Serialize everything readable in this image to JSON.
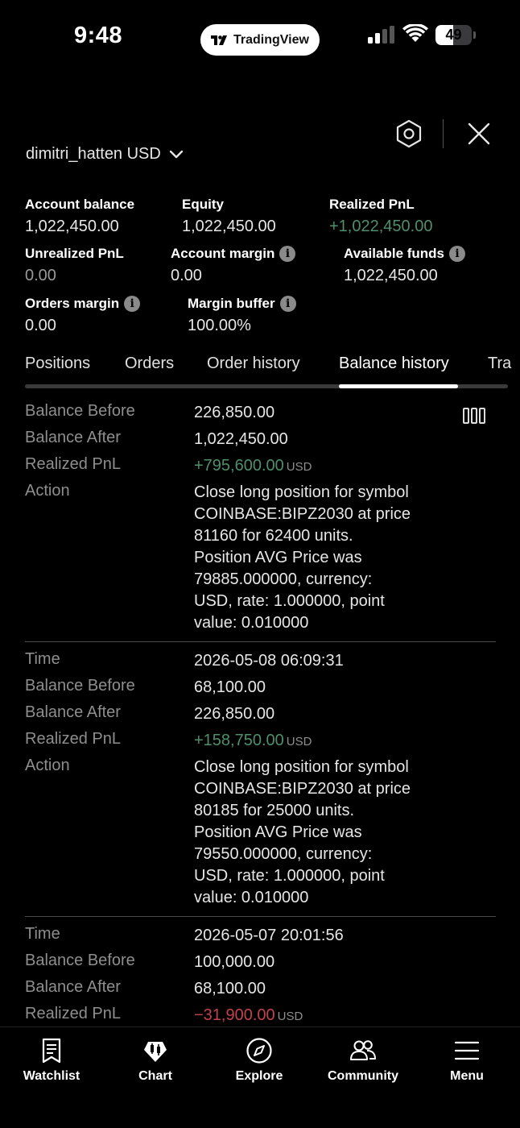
{
  "status_bar": {
    "time": "9:48",
    "app_name": "TradingView",
    "battery_percent": 49
  },
  "header": {
    "account_name": "dimitri_hatten USD",
    "icons": [
      "settings-hexagon-icon",
      "close-icon",
      "chevron-down-icon"
    ]
  },
  "stats": {
    "account_balance": {
      "label": "Account balance",
      "value": "1,022,450.00"
    },
    "equity": {
      "label": "Equity",
      "value": "1,022,450.00"
    },
    "realized_pnl": {
      "label": "Realized PnL",
      "value": "+1,022,450.00"
    },
    "unrealized_pnl": {
      "label": "Unrealized PnL",
      "value": "0.00"
    },
    "account_margin": {
      "label": "Account margin",
      "value": "0.00"
    },
    "available_funds": {
      "label": "Available funds",
      "value": "1,022,450.00"
    },
    "orders_margin": {
      "label": "Orders margin",
      "value": "0.00"
    },
    "margin_buffer": {
      "label": "Margin buffer",
      "value": "100.00%"
    }
  },
  "tabs": [
    {
      "label": "Positions",
      "active": false
    },
    {
      "label": "Orders",
      "active": false
    },
    {
      "label": "Order history",
      "active": false
    },
    {
      "label": "Balance history",
      "active": true
    },
    {
      "label": "Tra",
      "active": false
    }
  ],
  "field_labels": {
    "time": "Time",
    "balance_before": "Balance Before",
    "balance_after": "Balance After",
    "realized_pnl": "Realized PnL",
    "action": "Action"
  },
  "records": [
    {
      "balance_before": "226,850.00",
      "balance_after": "1,022,450.00",
      "realized_pnl": "+795,600.00",
      "currency": "USD",
      "action_lines": [
        "Close long position for symbol",
        "COINBASE:BIPZ2030 at price",
        "81160 for 62400 units.",
        "Position AVG Price was",
        "79885.000000, currency:",
        "USD, rate: 1.000000, point",
        "value: 0.010000"
      ]
    },
    {
      "time": "2026-05-08 06:09:31",
      "balance_before": "68,100.00",
      "balance_after": "226,850.00",
      "realized_pnl": "+158,750.00",
      "currency": "USD",
      "action_lines": [
        "Close long position for symbol",
        "COINBASE:BIPZ2030 at price",
        "80185 for 25000 units.",
        "Position AVG Price was",
        "79550.000000, currency:",
        "USD, rate: 1.000000, point",
        "value: 0.010000"
      ]
    },
    {
      "time": "2026-05-07 20:01:56",
      "balance_before": "100,000.00",
      "balance_after": "68,100.00",
      "realized_pnl": "−31,900.00",
      "currency": "USD"
    }
  ],
  "bottom_nav": [
    {
      "label": "Watchlist",
      "icon": "watchlist-icon"
    },
    {
      "label": "Chart",
      "icon": "chart-candles-icon"
    },
    {
      "label": "Explore",
      "icon": "compass-icon"
    },
    {
      "label": "Community",
      "icon": "community-icon"
    },
    {
      "label": "Menu",
      "icon": "menu-icon"
    }
  ],
  "colors": {
    "positive": "#4f8f6b",
    "negative": "#c2434b",
    "muted_label": "#8e8e8e",
    "background": "#000000"
  }
}
